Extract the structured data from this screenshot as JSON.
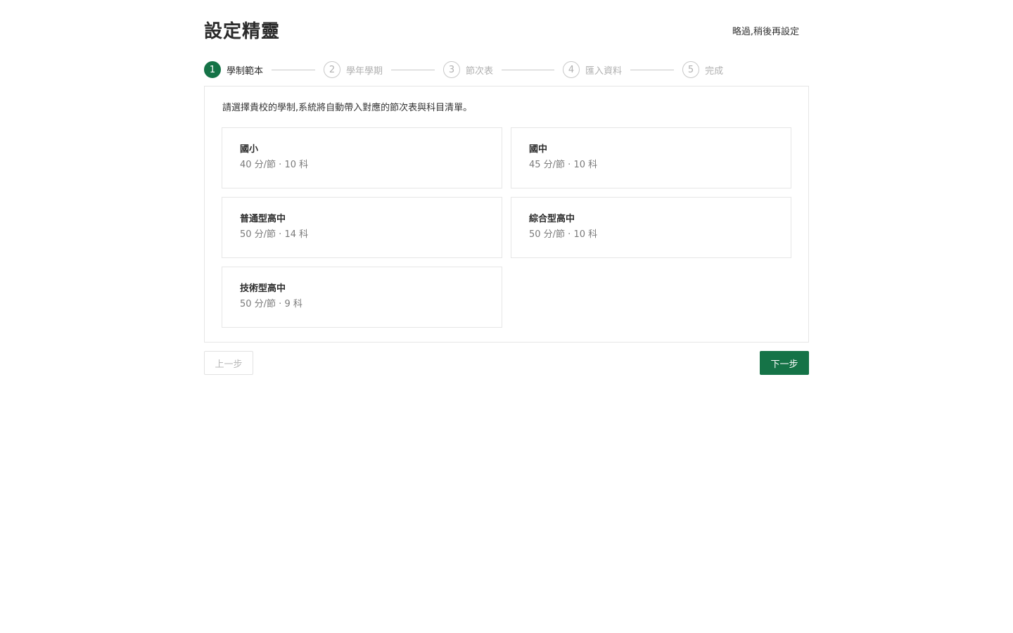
{
  "header": {
    "title": "設定精靈",
    "skip_label": "略過,稍後再設定"
  },
  "stepper": {
    "active_index": 0,
    "steps": [
      {
        "number": "1",
        "label": "學制範本"
      },
      {
        "number": "2",
        "label": "學年學期"
      },
      {
        "number": "3",
        "label": "節次表"
      },
      {
        "number": "4",
        "label": "匯入資料"
      },
      {
        "number": "5",
        "label": "完成"
      }
    ]
  },
  "main": {
    "intro": "請選擇貴校的學制,系統將自動帶入對應的節次表與科目清單。",
    "templates": [
      {
        "name": "國小",
        "meta": "40 分/節 · 10 科"
      },
      {
        "name": "國中",
        "meta": "45 分/節 · 10 科"
      },
      {
        "name": "普通型高中",
        "meta": "50 分/節 · 14 科"
      },
      {
        "name": "綜合型高中",
        "meta": "50 分/節 · 10 科"
      },
      {
        "name": "技術型高中",
        "meta": "50 分/節 · 9 科"
      }
    ]
  },
  "footer": {
    "prev_label": "上一步",
    "next_label": "下一步"
  },
  "colors": {
    "accent": "#157347",
    "inactive": "#b0b0b0",
    "border": "#e6e6e6"
  }
}
